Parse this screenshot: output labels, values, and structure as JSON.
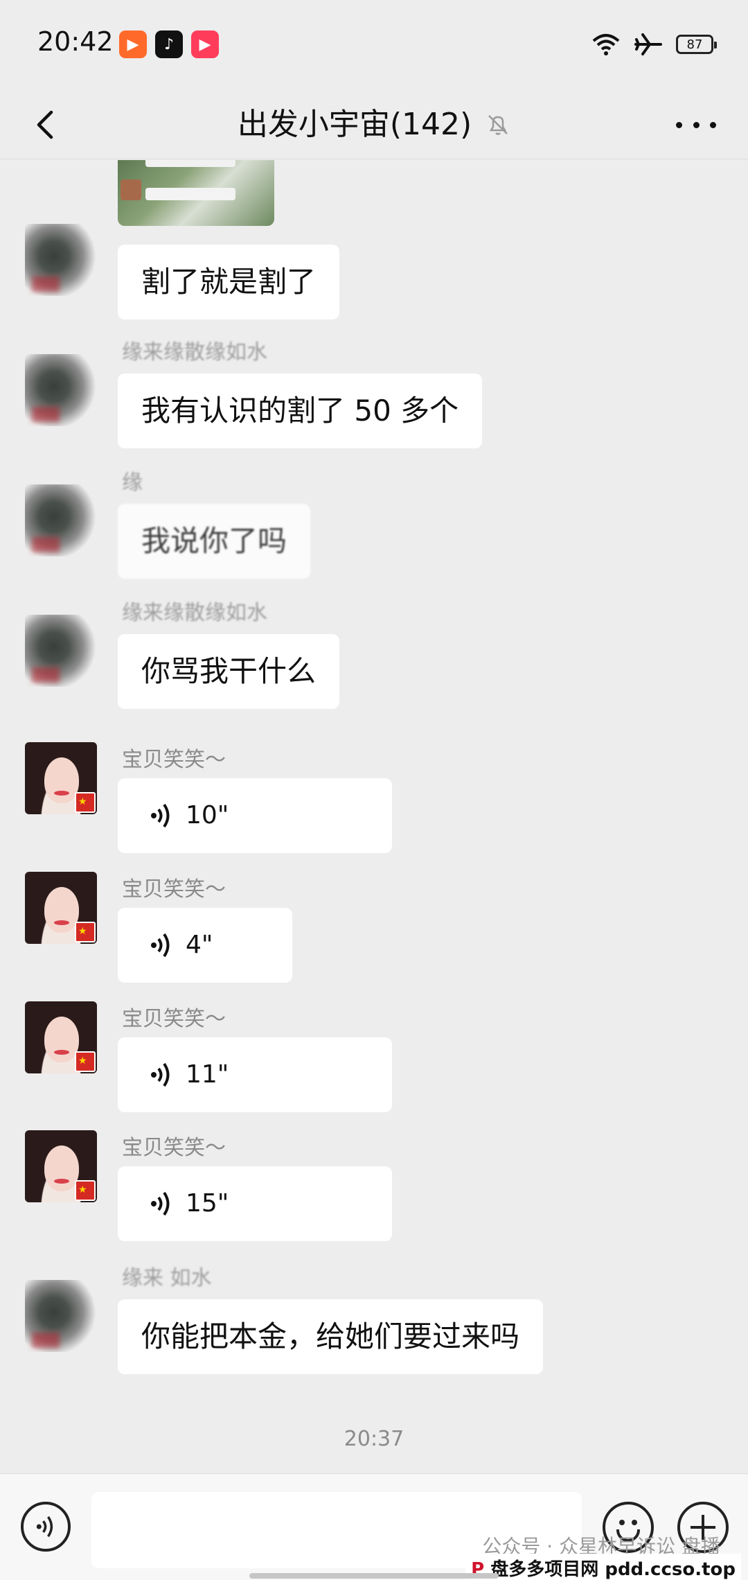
{
  "status_bar": {
    "time": "20:42",
    "battery": "87",
    "icons": [
      "kuaishou-icon",
      "tiktok-icon",
      "kuaishou-lite-icon",
      "wifi-icon",
      "airplane-icon",
      "battery-icon"
    ]
  },
  "header": {
    "title": "出发小宇宙(142)",
    "muted_icon": "bell-off-icon"
  },
  "messages": [
    {
      "type": "text",
      "sender": "",
      "text": "割了就是割了"
    },
    {
      "type": "text",
      "sender": "缘来缘散缘如水",
      "text": "我有认识的割了 50 多个"
    },
    {
      "type": "text",
      "sender": "缘",
      "text": "我说你了吗"
    },
    {
      "type": "text",
      "sender": "缘来缘散缘如水",
      "text": "你骂我干什么"
    },
    {
      "type": "voice",
      "sender": "宝贝笑笑～",
      "duration": "10\""
    },
    {
      "type": "voice",
      "sender": "宝贝笑笑～",
      "duration": "4\""
    },
    {
      "type": "voice",
      "sender": "宝贝笑笑～",
      "duration": "11\""
    },
    {
      "type": "voice",
      "sender": "宝贝笑笑～",
      "duration": "15\""
    },
    {
      "type": "text",
      "sender": "缘来    如水",
      "text": "你能把本金，给她们要过来吗"
    }
  ],
  "timestamp": "20:37",
  "input": {
    "placeholder": ""
  },
  "watermark": {
    "text": "公众号 · 众星林早诉讼 盘播",
    "logo_text": "盘多多项目网 pdd.ccso.top",
    "logo_letter": "P"
  }
}
